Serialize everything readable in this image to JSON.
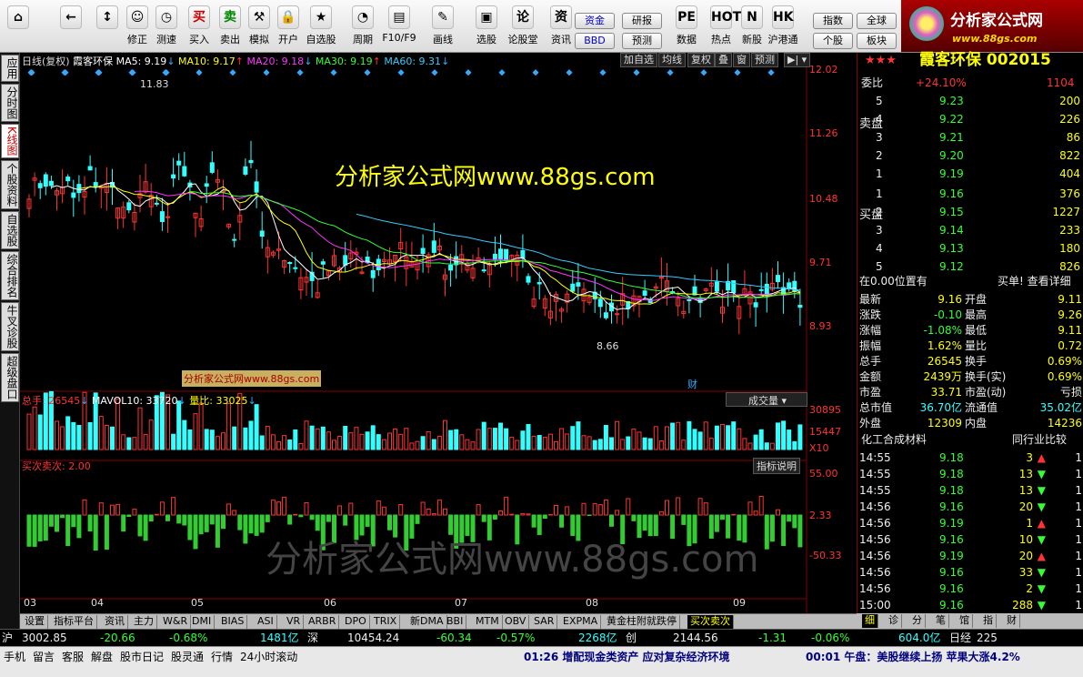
{
  "toolbar": {
    "items": [
      {
        "icon": "⌂",
        "label": ""
      },
      {
        "icon": "←",
        "label": ""
      },
      {
        "icon": "↕",
        "label": ""
      },
      {
        "icon": "☺",
        "label": "修正"
      },
      {
        "icon": "◷",
        "label": "测速"
      },
      {
        "icon": "买",
        "label": "买入"
      },
      {
        "icon": "卖",
        "label": "卖出"
      },
      {
        "icon": "⚒",
        "label": "模拟"
      },
      {
        "icon": "🔒",
        "label": "开户"
      },
      {
        "icon": "★",
        "label": "自选股"
      },
      {
        "icon": "◔",
        "label": "周期"
      },
      {
        "icon": "▤",
        "label": "F10/F9"
      },
      {
        "icon": "✎",
        "label": "画线"
      },
      {
        "icon": "▣",
        "label": "选股"
      },
      {
        "icon": "论",
        "label": "论股堂"
      },
      {
        "icon": "资",
        "label": "资讯"
      },
      {
        "icon": "PE",
        "label": "数据"
      },
      {
        "icon": "HOT",
        "label": "热点"
      },
      {
        "icon": "N",
        "label": "新股"
      },
      {
        "icon": "HK",
        "label": "沪港通"
      }
    ],
    "small_buttons": [
      "资金",
      "BBD",
      "研报",
      "预测",
      "指数",
      "个股",
      "全球",
      "板块"
    ]
  },
  "logo": {
    "title": "分析家公式网",
    "url": "www.88gs.com"
  },
  "leftnav": [
    "应用",
    "分时图",
    "K线图",
    "个股资料",
    "自选股",
    "综合排名",
    "牛叉诊股",
    "超级盘口"
  ],
  "chart": {
    "legend": {
      "period": "日线(复权)",
      "name": "霞客环保",
      "ma5": "MA5: 9.19",
      "ma10": "MA10: 9.17",
      "ma20": "MA20: 9.18",
      "ma30": "MA30: 9.19",
      "ma60": "MA60: 9.31"
    },
    "controls": [
      "加自选",
      "均线",
      "复权",
      "叠",
      "窗",
      "预测"
    ],
    "price_axis": [
      "12.02",
      "11.26",
      "10.48",
      "9.71",
      "8.93"
    ],
    "high_label": "11.83",
    "low_label": "8.66",
    "watermark_main": "分析家公式网www.88gs.com",
    "watermark_small": "分析家公式网www.88gs.com",
    "watermark_bottom": "分析家公式网www.88gs.com",
    "fin_marker": "财",
    "vol_legend": {
      "total": "总手: 26545",
      "mavol": "MAVOL10: 33720",
      "ratio": "量比: 33025"
    },
    "vol_dropdown": "成交量",
    "vol_axis": [
      "30895",
      "15447",
      "X10"
    ],
    "ind_legend": "买次卖次: 2.00",
    "ind_button": "指标说明",
    "ind_axis": [
      "55.00",
      "2.33",
      "-50.33"
    ],
    "months": [
      "03",
      "04",
      "05",
      "06",
      "07",
      "08",
      "09"
    ]
  },
  "chart_data": {
    "type": "candlestick",
    "title": "霞客环保 002015 日线(复权)",
    "y_range": [
      8.66,
      12.02
    ],
    "high": 11.83,
    "low": 8.66,
    "last": {
      "close": 9.16,
      "ma5": 9.19,
      "ma10": 9.17,
      "ma20": 9.18,
      "ma30": 9.19,
      "ma60": 9.31
    },
    "volume": {
      "total": 26545,
      "mavol10": 33720,
      "ratio": 33025,
      "axis": [
        30895,
        15447
      ]
    },
    "indicator": {
      "name": "买次卖次",
      "value": 2.0,
      "axis": [
        55.0,
        2.33,
        -50.33
      ]
    },
    "x_ticks": [
      "03",
      "04",
      "05",
      "06",
      "07",
      "08",
      "09"
    ]
  },
  "right": {
    "stars": "★★★",
    "title": "霞客环保 002015",
    "weibi": {
      "label": "委比",
      "pct": "+24.10%",
      "val": "1104"
    },
    "sell": [
      {
        "n": "5",
        "p": "9.23",
        "v": "200"
      },
      {
        "n": "4",
        "p": "9.22",
        "v": "226"
      },
      {
        "n": "3",
        "p": "9.21",
        "v": "86"
      },
      {
        "n": "2",
        "p": "9.20",
        "v": "822"
      },
      {
        "n": "1",
        "p": "9.19",
        "v": "404"
      }
    ],
    "buy": [
      {
        "n": "1",
        "p": "9.16",
        "v": "376"
      },
      {
        "n": "2",
        "p": "9.15",
        "v": "1227"
      },
      {
        "n": "3",
        "p": "9.14",
        "v": "233"
      },
      {
        "n": "4",
        "p": "9.13",
        "v": "180"
      },
      {
        "n": "5",
        "p": "9.12",
        "v": "826"
      }
    ],
    "sell_label": "卖盘",
    "buy_label": "买盘",
    "position": "在0.00位置有",
    "position_link": "买单! 查看详细",
    "stats": [
      {
        "l": "最新",
        "v": "9.16",
        "l2": "开盘",
        "v2": "9.11"
      },
      {
        "l": "涨跌",
        "v": "-0.10",
        "l2": "最高",
        "v2": "9.26"
      },
      {
        "l": "涨幅",
        "v": "-1.08%",
        "l2": "最低",
        "v2": "9.11"
      },
      {
        "l": "振幅",
        "v": "1.62%",
        "l2": "量比",
        "v2": "0.72"
      },
      {
        "l": "总手",
        "v": "26545",
        "l2": "换手",
        "v2": "0.69%"
      },
      {
        "l": "金额",
        "v": "2439万",
        "l2": "换手(实)",
        "v2": "0.69%"
      },
      {
        "l": "市盈",
        "v": "33.71",
        "l2": "市盈(动)",
        "v2": "亏损"
      },
      {
        "l": "总市值",
        "v": "36.70亿",
        "l2": "流通值",
        "v2": "35.02亿"
      },
      {
        "l": "外盘",
        "v": "12309",
        "l2": "内盘",
        "v2": "14236"
      }
    ],
    "industry": "化工合成材料",
    "industry_btn": "同行业比较",
    "ticks": [
      {
        "t": "14:55",
        "p": "9.18",
        "v": "3",
        "d": "up"
      },
      {
        "t": "14:55",
        "p": "9.18",
        "v": "13",
        "d": "down"
      },
      {
        "t": "14:55",
        "p": "9.18",
        "v": "13",
        "d": "down"
      },
      {
        "t": "14:56",
        "p": "9.16",
        "v": "20",
        "d": "down"
      },
      {
        "t": "14:56",
        "p": "9.19",
        "v": "1",
        "d": "up"
      },
      {
        "t": "14:56",
        "p": "9.16",
        "v": "10",
        "d": "down"
      },
      {
        "t": "14:56",
        "p": "9.19",
        "v": "20",
        "d": "up"
      },
      {
        "t": "14:56",
        "p": "9.16",
        "v": "33",
        "d": "down"
      },
      {
        "t": "14:56",
        "p": "9.16",
        "v": "2",
        "d": "down"
      },
      {
        "t": "15:00",
        "p": "9.16",
        "v": "288",
        "d": "down"
      }
    ],
    "tick_tail": "1"
  },
  "bottom_tabs": [
    "设置",
    "指标平台",
    "资讯",
    "主力",
    "W&R",
    "DMI",
    "BIAS",
    "ASI",
    "VR",
    "ARBR",
    "DPO",
    "TRIX",
    "新DMA",
    "BBI",
    "MTM",
    "OBV",
    "SAR",
    "EXPMA",
    "黄金柱附就跌停",
    "买次卖次"
  ],
  "right_tabs": [
    "细",
    "诊",
    "分",
    "笔",
    "馆",
    "指",
    "财"
  ],
  "status": {
    "sh_label": "沪",
    "sh_val": "3002.85",
    "sh_chg": "-20.66",
    "sh_pct": "-0.68%",
    "sh_amt": "1481亿",
    "sz_label": "深",
    "sz_val": "10454.24",
    "sz_chg": "-60.34",
    "sz_pct": "-0.57%",
    "sz_amt": "2268亿",
    "cy_label": "创",
    "cy_val": "2144.56",
    "cy_chg": "-1.31",
    "cy_pct": "-0.06%",
    "cy_amt": "604.0亿",
    "rj_label": "日经",
    "rj_val": "225"
  },
  "bottombar": {
    "items": [
      "手机",
      "留言",
      "客服",
      "解盘",
      "股市日记",
      "股灵通",
      "行情",
      "24小时滚动"
    ],
    "news1": "01:26 增配现金类资产 应对复杂经济环境",
    "news2": "00:01 午盘：美股继续上扬 苹果大涨4.2%"
  }
}
